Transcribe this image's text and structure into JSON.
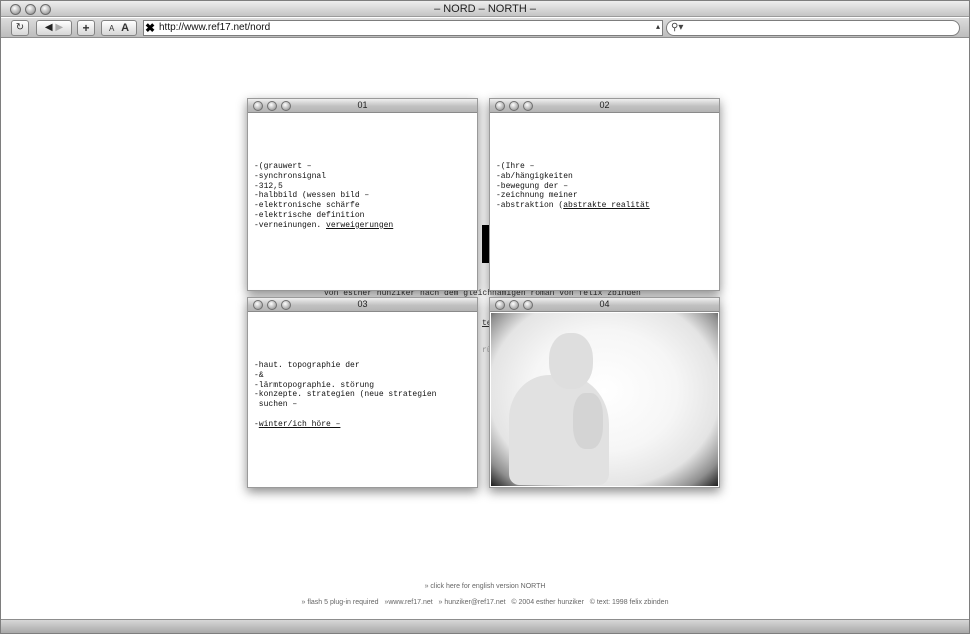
{
  "window": {
    "title": "– NORD – NORTH –"
  },
  "toolbar": {
    "reload_icon": "reload-icon",
    "back_icon": "back-arrow-icon",
    "forward_icon": "forward-arrow-icon",
    "add_bookmark_label": "+",
    "text_smaller_label": "A",
    "text_larger_label": "A",
    "url": "http://www.ref17.net/nord",
    "search_value": ""
  },
  "background": {
    "credit_line": "von esther hunziker nach dem gleichnamigen roman von felix zbinden",
    "fragment_1": "te",
    "fragment_2": "rü"
  },
  "panels": [
    {
      "number": "01",
      "lines": [
        "-(grauwert –",
        "-synchronsignal",
        "-312,5",
        "-halbbild (wessen bild –",
        "-elektronische schärfe",
        "-elektrische definition"
      ],
      "last_prefix": "-verneinungen. ",
      "link_text": "verweigerungen"
    },
    {
      "number": "02",
      "lines": [
        "-(Ihre –",
        "-ab/hängigkeiten",
        "-bewegung der –",
        "-zeichnung meiner"
      ],
      "last_prefix": "-abstraktion (",
      "link_text": "abstrakte realität"
    },
    {
      "number": "03",
      "lines": [
        "-haut. topographie der",
        "-&",
        "-lärmtopographie. störung",
        "-konzepte. strategien (neue strategien",
        " suchen –",
        ""
      ],
      "last_prefix": "-",
      "link_text": "winter/ich höre –"
    },
    {
      "number": "04",
      "image": "photo-of-person-in-fog"
    }
  ],
  "footer": {
    "english_link": "» click here for english version NORTH",
    "flash_note": "» flash 5 plug-in required",
    "site_link": "»www.ref17.net",
    "email_link": "» hunziker@ref17.net",
    "copyright": "© 2004 esther hunziker",
    "text_credit": "© text: 1998 felix zbinden"
  }
}
